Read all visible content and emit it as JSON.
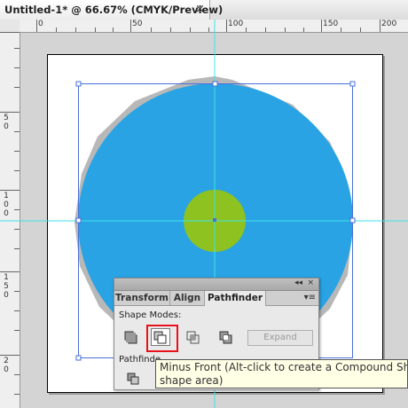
{
  "document_tab": {
    "title": "Untitled-1* @ 66.67% (CMYK/Preview)",
    "close_glyph": "×"
  },
  "ruler": {
    "horizontal_labels": [
      "0",
      "50",
      "100",
      "150",
      "200"
    ],
    "vertical_labels": [
      [
        "5",
        "0"
      ],
      [
        "1",
        "0",
        "0"
      ],
      [
        "1",
        "5",
        "0"
      ],
      [
        "2",
        "0"
      ]
    ]
  },
  "artwork": {
    "circle_color": "#29a3e3",
    "inner_circle_color": "#8ec220",
    "shadow_color": "#b8b8b8",
    "guide_color": "#3fe3e8",
    "selection_color": "#4a6fd8"
  },
  "panel": {
    "tabs": [
      "Transform",
      "Align",
      "Pathfinder"
    ],
    "active_tab": "Pathfinder",
    "shape_modes_label": "Shape Modes:",
    "pathfinders_label": "Pathfinde",
    "expand_label": "Expand"
  },
  "tooltip": {
    "line1": "Minus Front (Alt-click to create a Compound Shape",
    "line2": "shape area)"
  },
  "highlight_color": "#e8101b"
}
